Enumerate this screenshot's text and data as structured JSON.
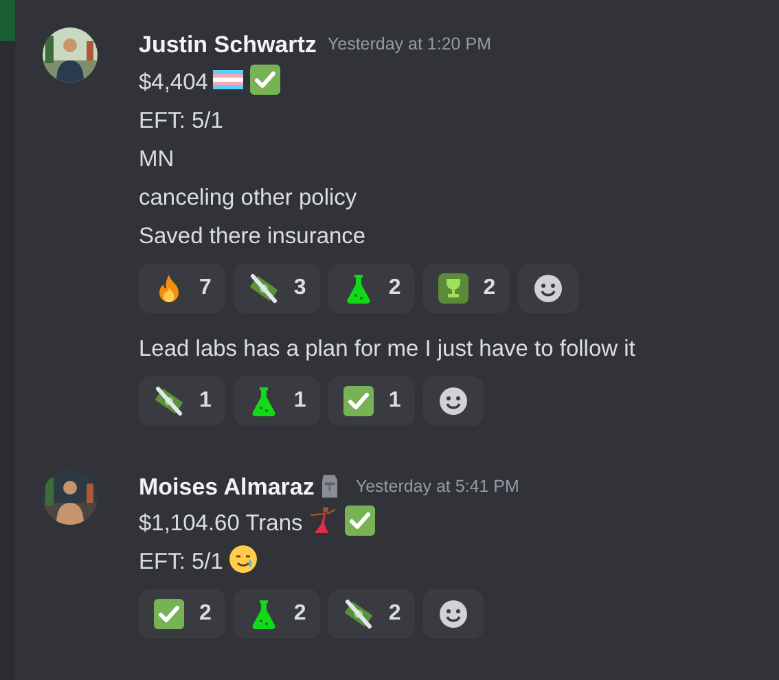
{
  "messages": [
    {
      "avatar": {
        "kind": "picture"
      },
      "author": "Justin Schwartz",
      "timestamp": "Yesterday at 1:20 PM",
      "groups": [
        {
          "lines": [
            [
              {
                "text": "$4,404"
              },
              {
                "kind": "flag"
              },
              {
                "kind": "check"
              }
            ],
            [
              {
                "text": "EFT: 5/1"
              }
            ],
            [
              {
                "text": "MN"
              }
            ],
            [
              {
                "text": "canceling other policy"
              }
            ],
            [
              {
                "text": "Saved there insurance"
              }
            ]
          ],
          "reactions": [
            {
              "kind": "fire",
              "count": "7"
            },
            {
              "kind": "money",
              "count": "3"
            },
            {
              "kind": "flask",
              "count": "2"
            },
            {
              "kind": "trophy",
              "count": "2"
            },
            {
              "kind": "add"
            }
          ]
        },
        {
          "lines": [
            [
              {
                "text": "Lead labs has a plan for me I just have to follow it"
              }
            ]
          ],
          "reactions": [
            {
              "kind": "money",
              "count": "1"
            },
            {
              "kind": "flask",
              "count": "1"
            },
            {
              "kind": "check",
              "count": "1"
            },
            {
              "kind": "add"
            }
          ]
        }
      ]
    },
    {
      "avatar": {
        "kind": "picture"
      },
      "author": "Moises Almaraz",
      "author_badges": [
        {
          "kind": "moai"
        }
      ],
      "timestamp": "Yesterday at 5:41 PM",
      "groups": [
        {
          "lines": [
            [
              {
                "text": "$1,104.60 Trans"
              },
              {
                "kind": "dancer"
              },
              {
                "kind": "check"
              }
            ],
            [
              {
                "text": "EFT: 5/1"
              },
              {
                "kind": "tearsmile"
              }
            ]
          ],
          "reactions": [
            {
              "kind": "check",
              "count": "2"
            },
            {
              "kind": "flask",
              "count": "2"
            },
            {
              "kind": "money",
              "count": "2"
            },
            {
              "kind": "add"
            }
          ]
        }
      ]
    }
  ]
}
